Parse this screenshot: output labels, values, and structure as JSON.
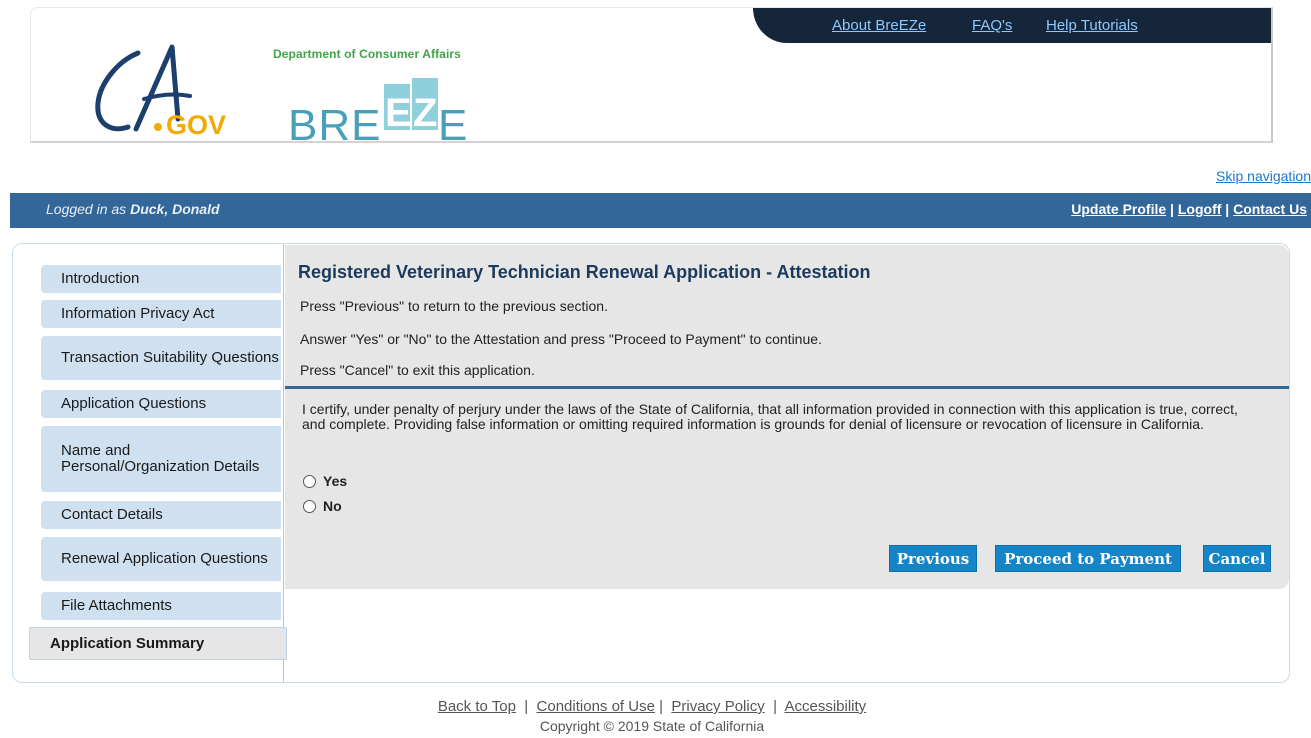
{
  "header": {
    "top_links": [
      "About BreEZe",
      "FAQ's",
      "Help Tutorials"
    ],
    "ca_logo_text": "CA.GOV",
    "dca_label": "Department of Consumer Affairs",
    "breeze_logo_text": "BREEZE"
  },
  "skip_navigation": "Skip navigation",
  "user_bar": {
    "logged_in_prefix": "Logged in as",
    "user_name": "Duck, Donald",
    "update_profile": "Update Profile",
    "logoff": "Logoff",
    "contact_us": "Contact Us",
    "separator": "|"
  },
  "sidebar": {
    "items": [
      {
        "label": "Introduction"
      },
      {
        "label": "Information Privacy Act"
      },
      {
        "label": "Transaction Suitability Questions"
      },
      {
        "label": "Application Questions"
      },
      {
        "label": "Name and Personal/Organization Details"
      },
      {
        "label": "Contact Details"
      },
      {
        "label": "Renewal Application Questions"
      },
      {
        "label": "File Attachments"
      },
      {
        "label": "Application Summary",
        "active": true
      }
    ]
  },
  "main": {
    "title": "Registered Veterinary Technician Renewal Application - Attestation",
    "instructions": [
      "Press \"Previous\" to return to the previous section.",
      "Answer \"Yes\" or \"No\" to the Attestation and press \"Proceed to Payment\" to continue.",
      "Press \"Cancel\" to exit this application."
    ],
    "certification": "I certify, under penalty of perjury under the laws of the State of California, that all information provided in connection with this application is true, correct, and complete. Providing false information or omitting required information is grounds for denial of licensure or revocation of licensure in California.",
    "options": [
      "Yes",
      "No"
    ],
    "buttons": {
      "previous": "Previous",
      "proceed": "Proceed to Payment",
      "cancel": "Cancel"
    }
  },
  "footer": {
    "links": [
      "Back to Top",
      "Conditions of Use",
      "Privacy Policy",
      "Accessibility"
    ],
    "separator": "|",
    "copyright": "Copyright © 2019 State of California"
  },
  "colors": {
    "user_bar": "#336699",
    "nav_item": "#cfe0f0",
    "button": "#1585c8",
    "content_bg": "#e6e6e6",
    "top_links_bg": "#15263b"
  }
}
